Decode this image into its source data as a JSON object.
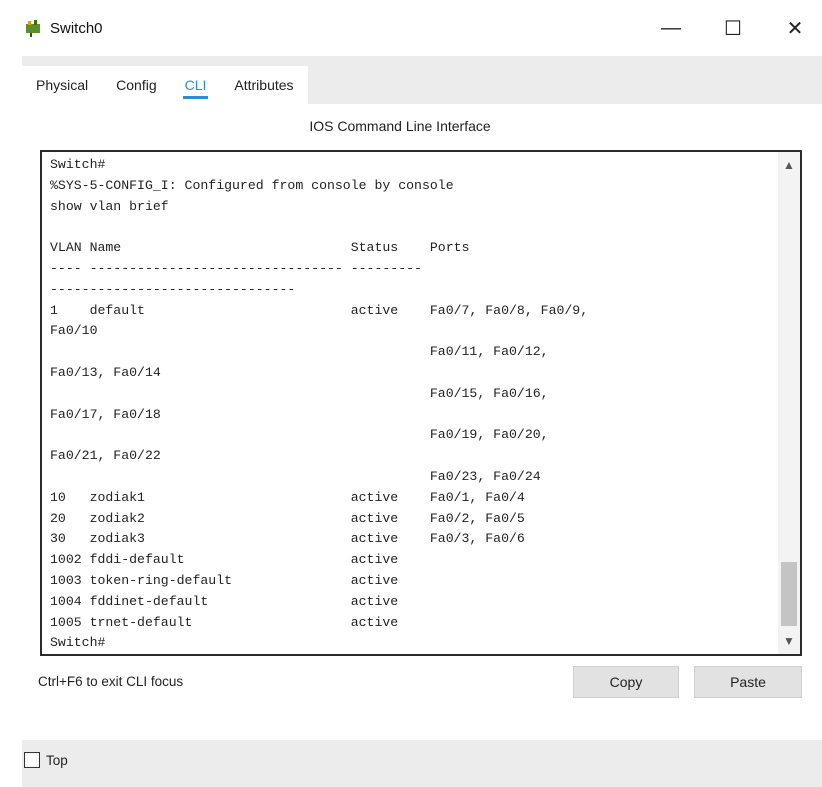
{
  "window": {
    "title": "Switch0",
    "icon": "switch-icon",
    "controls": [
      "—",
      "☐",
      "✕"
    ]
  },
  "tabs": [
    {
      "label": "Physical",
      "active": false
    },
    {
      "label": "Config",
      "active": false
    },
    {
      "label": "CLI",
      "active": true
    },
    {
      "label": "Attributes",
      "active": false
    }
  ],
  "panel": {
    "title": "IOS Command Line Interface"
  },
  "terminal": {
    "lines": [
      "Switch#",
      "%SYS-5-CONFIG_I: Configured from console by console",
      "show vlan brief",
      "",
      "VLAN Name                             Status    Ports",
      "---- -------------------------------- ---------",
      "-------------------------------",
      "1    default                          active    Fa0/7, Fa0/8, Fa0/9,",
      "Fa0/10",
      "                                                Fa0/11, Fa0/12,",
      "Fa0/13, Fa0/14",
      "                                                Fa0/15, Fa0/16,",
      "Fa0/17, Fa0/18",
      "                                                Fa0/19, Fa0/20,",
      "Fa0/21, Fa0/22",
      "                                                Fa0/23, Fa0/24",
      "10   zodiak1                          active    Fa0/1, Fa0/4",
      "20   zodiak2                          active    Fa0/2, Fa0/5",
      "30   zodiak3                          active    Fa0/3, Fa0/6",
      "1002 fddi-default                     active",
      "1003 token-ring-default               active",
      "1004 fddinet-default                  active",
      "1005 trnet-default                    active",
      "Switch#"
    ]
  },
  "footer": {
    "hint": "Ctrl+F6 to exit CLI focus",
    "copy_label": "Copy",
    "paste_label": "Paste",
    "top_label": "Top"
  },
  "colors": {
    "accent": "#2a8fd6",
    "panel_bg": "#ececec",
    "button_bg": "#e2e2e2"
  }
}
